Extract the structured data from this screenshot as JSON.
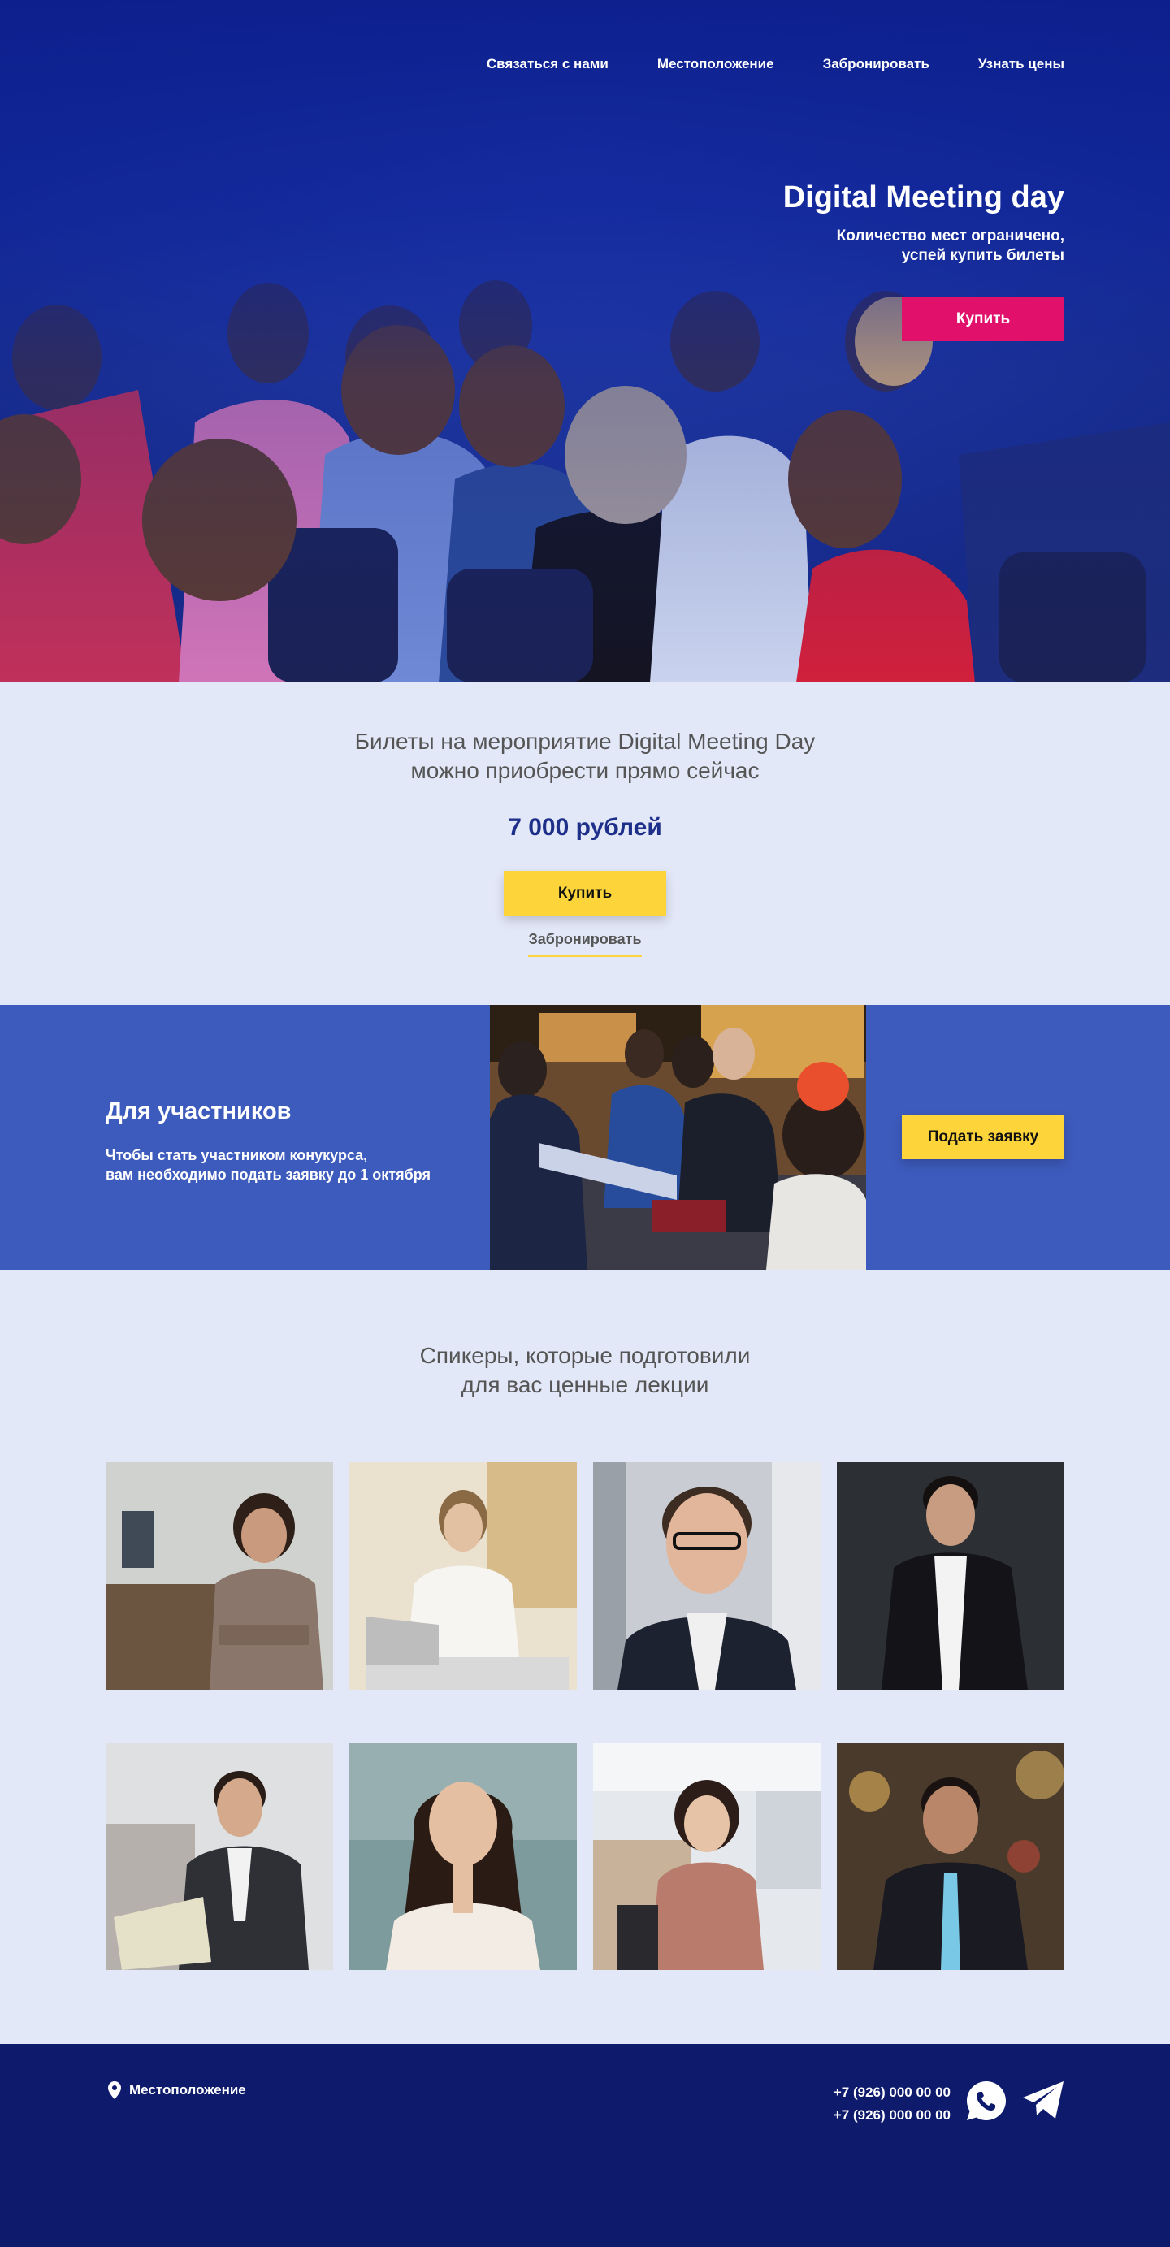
{
  "nav": {
    "contact": "Связаться с нами",
    "location": "Местоположение",
    "reserve": "Забронировать",
    "prices": "Узнать цены"
  },
  "hero": {
    "title": "Digital Meeting day",
    "subtitle_line1": "Количество мест ограничено,",
    "subtitle_line2": "успей купить билеты",
    "buy_label": "Купить"
  },
  "tickets": {
    "text_line1": "Билеты на мероприятие Digital Meeting Day",
    "text_line2": "можно приобрести прямо сейчас",
    "price": "7 000 рублей",
    "buy_label": "Купить",
    "reserve_label": "Забронировать"
  },
  "participants": {
    "title": "Для участников",
    "text_line1": "Чтобы стать участником конукурса,",
    "text_line2": "вам необходимо подать заявку до 1 октября",
    "apply_label": "Подать заявку"
  },
  "speakers": {
    "title_line1": "Спикеры, которые подготовили",
    "title_line2": "для вас ценные лекции",
    "photo_count": 8
  },
  "footer": {
    "location_label": "Местоположение",
    "phone1": "+7 (926) 000 00 00",
    "phone2": "+7 (926) 000 00 00",
    "icons": [
      "location-pin-icon",
      "whatsapp-icon",
      "telegram-icon"
    ]
  },
  "colors": {
    "hero_blue": "#1a35a5",
    "pink": "#e0106b",
    "yellow": "#fdd53a",
    "light_bg": "#e3e8f8",
    "participants_bg": "#3d5bbd",
    "footer_bg": "#0e1a6b",
    "price": "#1e2f8a"
  }
}
